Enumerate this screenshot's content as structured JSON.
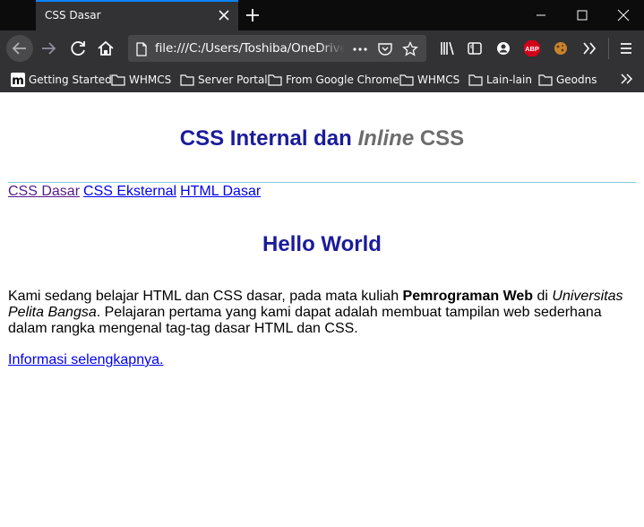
{
  "browser": {
    "tab": {
      "title": "CSS Dasar"
    },
    "url": "file:///C:/Users/Toshiba/OneDrive/K",
    "bookmarks": [
      {
        "label": "Getting Started",
        "icon": "getting-started-icon"
      },
      {
        "label": "WHMCS",
        "icon": "folder-icon"
      },
      {
        "label": "Server Portal",
        "icon": "folder-icon"
      },
      {
        "label": "From Google Chrome",
        "icon": "folder-icon"
      },
      {
        "label": "WHMCS",
        "icon": "folder-icon"
      },
      {
        "label": "Lain-lain",
        "icon": "folder-icon"
      },
      {
        "label": "Geodns",
        "icon": "folder-icon"
      }
    ],
    "abp_label": "ABP",
    "colors": {
      "chrome_bg": "#0c0c0d",
      "toolbar_bg": "#323234",
      "url_bg": "#474749",
      "accent": "#0a84ff",
      "abp_red": "#d0021b"
    }
  },
  "page": {
    "title_main": "CSS Internal dan",
    "title_inline": "Inline",
    "title_tail": "CSS",
    "nav": [
      "CSS Dasar",
      "CSS Eksternal",
      "HTML Dasar"
    ],
    "heading": "Hello World",
    "para": {
      "t1": "Kami sedang belajar HTML dan CSS dasar, pada mata kuliah ",
      "b1": "Pemrograman Web",
      "t2": " di ",
      "i1": "Universitas Pelita Bangsa",
      "t3": ". Pelajaran pertama yang kami dapat adalah membuat tampilan web sederhana dalam rangka mengenal tag-tag dasar HTML dan CSS."
    },
    "more_link": "Informasi selengkapnya.",
    "colors": {
      "heading": "#1b1b9b",
      "inline_word": "#6d6d6d",
      "rule": "#7fc7d7",
      "link": "#0000ee",
      "visited": "#551a8b"
    }
  }
}
